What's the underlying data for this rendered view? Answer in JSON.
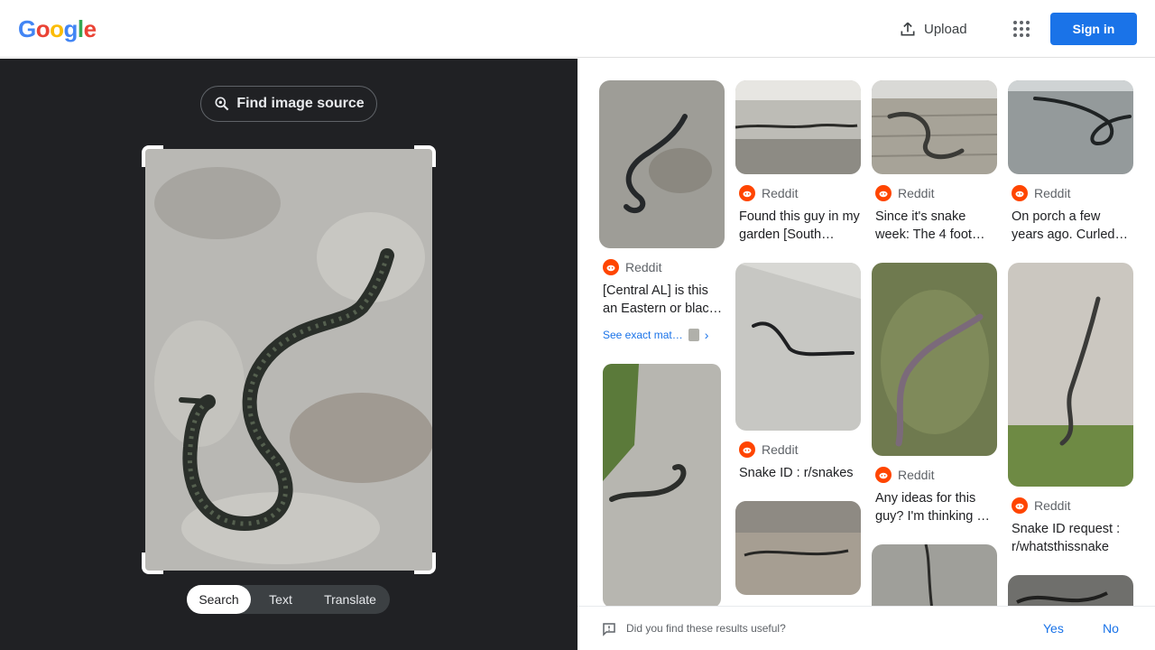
{
  "header": {
    "logo_letters": [
      "G",
      "o",
      "o",
      "g",
      "l",
      "e"
    ],
    "upload_label": "Upload",
    "signin_label": "Sign in"
  },
  "left_panel": {
    "find_source_label": "Find image source",
    "modes": [
      "Search",
      "Text",
      "Translate"
    ],
    "active_mode": "Search"
  },
  "results": [
    {
      "source": "Reddit",
      "title": "[Central AL] is this an Eastern or blac…",
      "exact_match": "See exact mat…"
    },
    {
      "source": "Reddit",
      "title": "Found this guy in my garden [South…"
    },
    {
      "source": "Reddit",
      "title": "Since it's snake week: The 4 foot…"
    },
    {
      "source": "Reddit",
      "title": "On porch a few years ago. Curled…"
    },
    {
      "source": "Reddit",
      "title": "Snake ID : r/snakes"
    },
    {
      "source": "Reddit",
      "title": "Any ideas for this guy? I'm thinking …"
    },
    {
      "source": "Reddit",
      "title": "Snake ID request : r/whatsthissnake"
    }
  ],
  "feedback": {
    "question": "Did you find these results useful?",
    "yes_label": "Yes",
    "no_label": "No"
  },
  "colors": {
    "accent": "#1a73e8",
    "dark_panel": "#202124",
    "reddit": "#ff4500"
  }
}
